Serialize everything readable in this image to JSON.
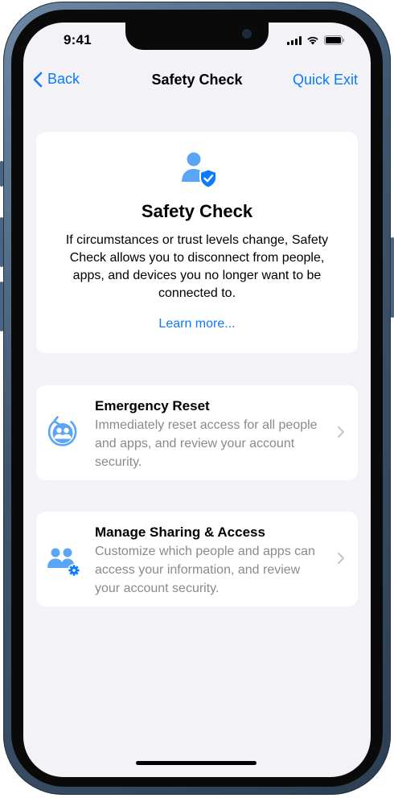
{
  "status_bar": {
    "time": "9:41"
  },
  "nav": {
    "back_label": "Back",
    "title": "Safety Check",
    "exit_label": "Quick Exit"
  },
  "hero": {
    "icon": "person-shield-icon",
    "title": "Safety Check",
    "description": "If circumstances or trust levels change, Safety Check allows you to disconnect from people, apps, and devices you no longer want to be connected to.",
    "link": "Learn more..."
  },
  "options": [
    {
      "icon": "emergency-reset-icon",
      "title": "Emergency Reset",
      "description": "Immediately reset access for all people and apps, and review your account security."
    },
    {
      "icon": "manage-sharing-icon",
      "title": "Manage Sharing & Access",
      "description": "Customize which people and apps can access your information, and review your account security."
    }
  ],
  "colors": {
    "accent": "#0a7aff",
    "icon_blue": "#5aa5f5",
    "background": "#f2f2f7",
    "card": "#ffffff",
    "secondary_text": "#8a8a8e",
    "frame": "#3f5670"
  }
}
